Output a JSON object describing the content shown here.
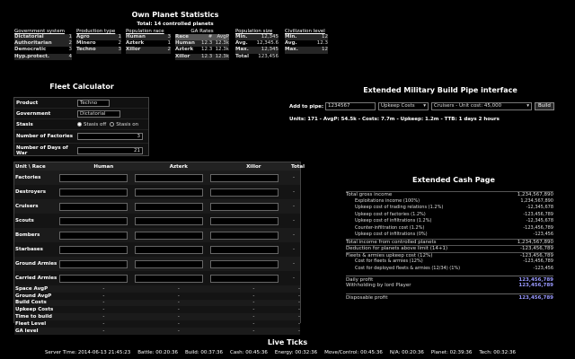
{
  "planet": {
    "title": "Own Planet Statistics",
    "subtitle": "Total: 14 controlled planets",
    "government": {
      "header": "Government system",
      "rows": [
        [
          "Dictatorial",
          "1"
        ],
        [
          "Authoritarian",
          "2"
        ],
        [
          "Democratic",
          "3"
        ],
        [
          "Hyp.protect.",
          "4"
        ]
      ]
    },
    "production": {
      "header": "Production type",
      "rows": [
        [
          "Agro",
          "1"
        ],
        [
          "Minero",
          "2"
        ],
        [
          "Techno",
          "3"
        ]
      ]
    },
    "population_race": {
      "header": "Population race",
      "rows": [
        [
          "Human",
          "3"
        ],
        [
          "Azterk",
          "1"
        ],
        [
          "Xillor",
          "2"
        ]
      ]
    },
    "ga_rates": {
      "header": "GA Rates",
      "cols": [
        "Race",
        "#",
        "AvgP"
      ],
      "rows": [
        [
          "Human",
          "12.3",
          "12.3k"
        ],
        [
          "Azterk",
          "12.3",
          "12.3k"
        ],
        [
          "Xillor",
          "12.3",
          "12.3k"
        ]
      ]
    },
    "population_size": {
      "header": "Population size",
      "rows": [
        [
          "Min.",
          "12,345"
        ],
        [
          "Avg.",
          "12,345.6"
        ],
        [
          "Max.",
          "12,345"
        ],
        [
          "Total",
          "123,456"
        ]
      ]
    },
    "civ_level": {
      "header": "Civilization level",
      "rows": [
        [
          "Min.",
          "12"
        ],
        [
          "Avg.",
          "12.3"
        ],
        [
          "Max.",
          "12"
        ]
      ]
    }
  },
  "fleet_calc": {
    "title": "Fleet Calculator",
    "product_label": "Product",
    "product_value": "Techno",
    "government_label": "Government",
    "government_value": "Dictatorial",
    "stasis_label": "Stasis",
    "stasis_off": "Stasis off",
    "stasis_on": "Stasis on",
    "factories_label": "Number of Factories",
    "factories_value": "3",
    "days_label": "Number of Days of War",
    "days_value": "21"
  },
  "fleet_table": {
    "headers": [
      "Unit \\ Race",
      "Human",
      "Azterk",
      "Xillor",
      "Total"
    ],
    "unit_rows": [
      "Factories",
      "Destroyers",
      "Cruisers",
      "Scouts",
      "Bombers",
      "Starbases",
      "Ground Armies",
      "Carried Armies"
    ],
    "summary_rows": [
      "Space AvgP",
      "Ground AvgP",
      "Build Costs",
      "Upkeep Costs",
      "Time to build",
      "Fleet Level",
      "GA level"
    ],
    "dash": "-"
  },
  "pipe": {
    "title": "Extended Military Build Pipe interface",
    "add_label": "Add to pipe:",
    "amount_value": "1234567",
    "costs_select": "Upkeep Costs",
    "unit_select": "Cruisers - Unit cost: 45,000",
    "build_label": "Build",
    "summary": "Units: 171 - AvgP: 54.5k - Costs: 7.7m - Upkeep: 1.2m - TTB: 1 days 2 hours"
  },
  "cash": {
    "title": "Extended Cash Page",
    "rows": [
      [
        "Total gross income",
        "1,234,567,890"
      ],
      [
        "Exploitations income (100%)",
        "1,234,567,890"
      ],
      [
        "Upkeep cost of trading relations (1.2%)",
        "-12,345,678"
      ],
      [
        "Upkeep cost of factories (1.2%)",
        "-123,456,789"
      ],
      [
        "Upkeep cost of infiltrations (1.2%)",
        "-12,345,678"
      ],
      [
        "Counter-infiltration cost (1.2%)",
        "-123,456,789"
      ],
      [
        "Upkeep cost of infiltrations (0%)",
        "-123,456"
      ],
      [
        "Total income from controlled planets",
        "1,234,567,890"
      ],
      [
        "Deduction for planets above limit (14+1)",
        "-123,456,789"
      ],
      [
        "Fleets & armies upkeep cost (12%)",
        "-123,456,789"
      ],
      [
        "Cost for fleets & armies (12%)",
        "-123,456,789"
      ],
      [
        "Cost for deployed fleets & armies (12/34) (1%)",
        "-123,456"
      ]
    ],
    "daily_label": "Daily profit",
    "daily_value": "123,456,789",
    "withhold_label": "Withholding by lord Player",
    "withhold_value": "123,456,789",
    "disposable_label": "Disposable profit",
    "disposable_value": "123,456,789"
  },
  "ticks": {
    "title": "Live Ticks",
    "items": [
      "Server Time: 2014-06-13 21:45:23",
      "Battle: 00:20:36",
      "Build: 00:37:36",
      "Cash: 00:45:36",
      "Energy: 00:32:36",
      "Move/Control: 00:45:36",
      "N/A: 00:20:36",
      "Planet: 02:39:36",
      "Tech: 00:32:36"
    ]
  },
  "colors": {
    "accent": "#9999ff",
    "background": "#000000"
  }
}
